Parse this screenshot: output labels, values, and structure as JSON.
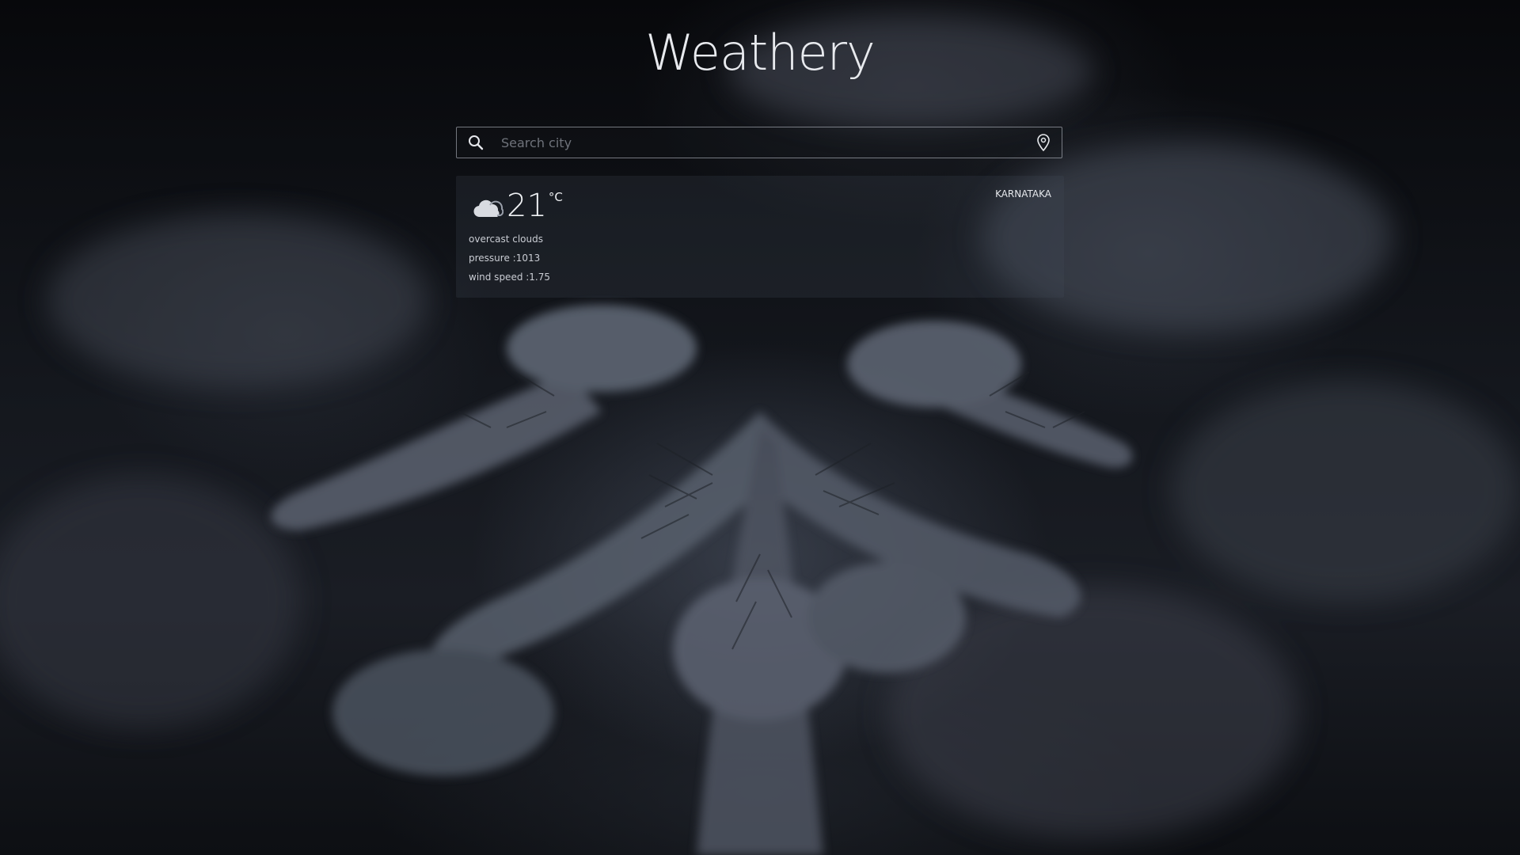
{
  "app": {
    "title": "Weathery"
  },
  "search": {
    "placeholder": "Search city",
    "value": "",
    "search_icon": "search-icon",
    "location_icon": "location-pin-icon"
  },
  "weather": {
    "icon": "cloud-icon",
    "temperature": "21",
    "unit": "°C",
    "region": "KARNATAKA",
    "description": "overcast clouds",
    "pressure": "pressure :1013",
    "wind_speed": "wind speed :1.75"
  },
  "colors": {
    "background": "#0b0d12",
    "text": "#e8eaee",
    "border": "#c8cdd7"
  }
}
